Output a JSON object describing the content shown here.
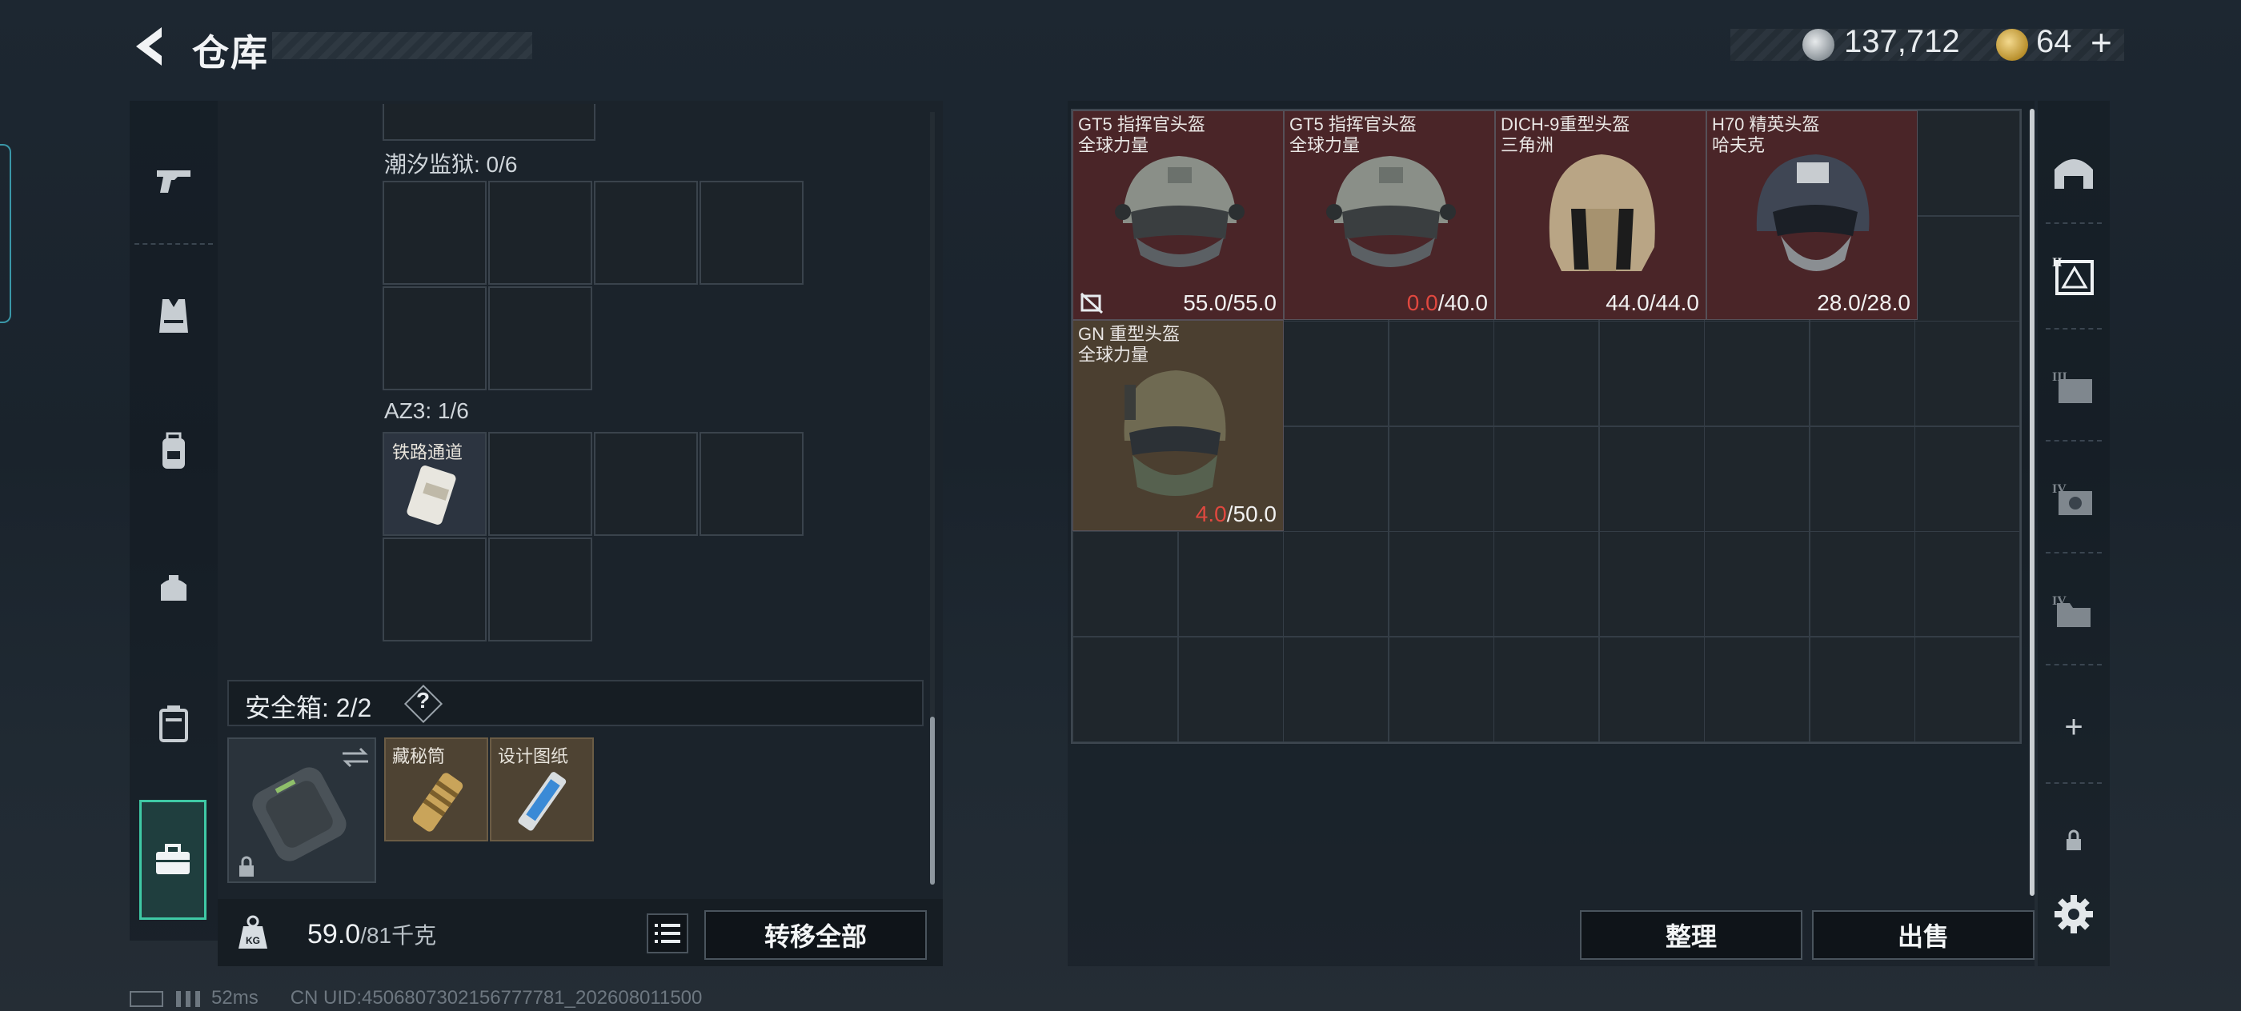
{
  "header": {
    "title": "仓库",
    "silver_amount": "137,712",
    "gold_amount": "64",
    "plus": "+"
  },
  "left_sidebar": {
    "tabs": [
      {
        "icon": "pistol-icon"
      },
      {
        "icon": "vest-icon"
      },
      {
        "icon": "backpack-icon"
      },
      {
        "icon": "pouch-icon"
      },
      {
        "icon": "case-icon"
      },
      {
        "icon": "toolbox-icon",
        "active": true
      }
    ]
  },
  "containers": {
    "section1_label": "潮汐监狱: 0/6",
    "section2_label": "AZ3: 1/6",
    "az3_item": "铁路通道"
  },
  "safe_box": {
    "label": "安全箱: 2/2",
    "help": "?",
    "items": [
      {
        "name": "藏秘筒"
      },
      {
        "name": "设计图纸"
      }
    ]
  },
  "bottom_bar": {
    "weight_icon_label": "KG",
    "weight_current": "59.0",
    "weight_max": "/81千克",
    "transfer_all": "转移全部"
  },
  "stash": {
    "helmets": [
      {
        "name_line1": "GT5 指挥官头盔",
        "name_line2": "全球力量",
        "dura_current": "55.0",
        "dura_max": "/55.0",
        "damaged": false,
        "color": "#4a2528"
      },
      {
        "name_line1": "GT5 指挥官头盔",
        "name_line2": "全球力量",
        "dura_current": "0.0",
        "dura_max": "/40.0",
        "damaged": true,
        "color": "#4a2528"
      },
      {
        "name_line1": "DICH-9重型头盔",
        "name_line2": "三角洲",
        "dura_current": "44.0",
        "dura_max": "/44.0",
        "damaged": false,
        "color": "#4a2528"
      },
      {
        "name_line1": "H70 精英头盔",
        "name_line2": "哈夫克",
        "dura_current": "28.0",
        "dura_max": "/28.0",
        "damaged": false,
        "color": "#4a2528"
      },
      {
        "name_line1": "GN 重型头盔",
        "name_line2": "全球力量",
        "dura_current": "4.0",
        "dura_max": "/50.0",
        "damaged": true,
        "color": "#4b3f30"
      }
    ],
    "sort_label": "整理",
    "sell_label": "出售"
  },
  "right_sidebar": {
    "tabs": [
      {
        "icon": "helmet-tab-icon"
      },
      {
        "icon": "armor-tier-ii-icon"
      },
      {
        "icon": "armor-tier-iii-icon"
      },
      {
        "icon": "armor-tier-iv-icon"
      },
      {
        "icon": "folder-tier-iv-icon"
      },
      {
        "icon": "add-icon",
        "text": "+"
      },
      {
        "icon": "lock-icon"
      },
      {
        "icon": "settings-icon"
      }
    ]
  },
  "status": {
    "ping": "52ms",
    "uid": "CN UID:4506807302156777781_202608011500"
  }
}
